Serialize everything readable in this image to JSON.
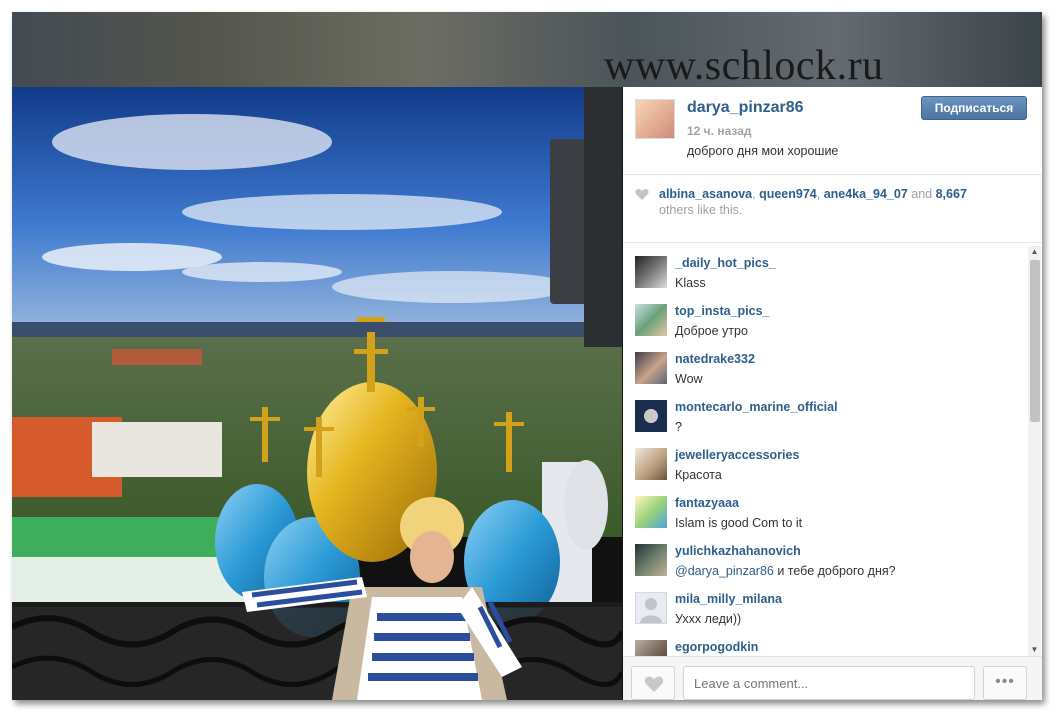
{
  "watermark": "www.schlock.ru",
  "post": {
    "username": "darya_pinzar86",
    "time": "12 ч. назад",
    "caption": "доброго дня мои хорошие",
    "follow_label": "Подписаться"
  },
  "likes": {
    "users": [
      "albina_asanova",
      "queen974",
      "ane4ka_94_07"
    ],
    "sep": ", ",
    "and": " and ",
    "count": "8,667",
    "tail": "others like this."
  },
  "comments": [
    {
      "user": "_daily_hot_pics_",
      "text": "Klass"
    },
    {
      "user": "top_insta_pics_",
      "text": "Доброе утро"
    },
    {
      "user": "natedrake332",
      "text": "Wow"
    },
    {
      "user": "montecarlo_marine_official",
      "text": "?"
    },
    {
      "user": "jewelleryaccessories",
      "text": "Красота"
    },
    {
      "user": "fantazyaaa",
      "text": "Islam is good Com to it"
    },
    {
      "user": "yulichkazhahanovich",
      "mention": "@darya_pinzar86",
      "text": " и тебе доброго дня?"
    },
    {
      "user": "mila_milly_milana",
      "text": "Ухxx леди))"
    },
    {
      "user": "egorpogodkin",
      "text": ""
    }
  ],
  "footer": {
    "comment_placeholder": "Leave a comment...",
    "more_label": "•••"
  },
  "icons": {
    "heart": "heart-icon",
    "more": "more-dots-icon",
    "scroll_up": "scroll-up-arrow-icon",
    "scroll_down": "scroll-down-arrow-icon"
  },
  "colors": {
    "link": "#2d5f8c",
    "follow_button": "#4a76a3",
    "muted": "#a1a1a1"
  }
}
